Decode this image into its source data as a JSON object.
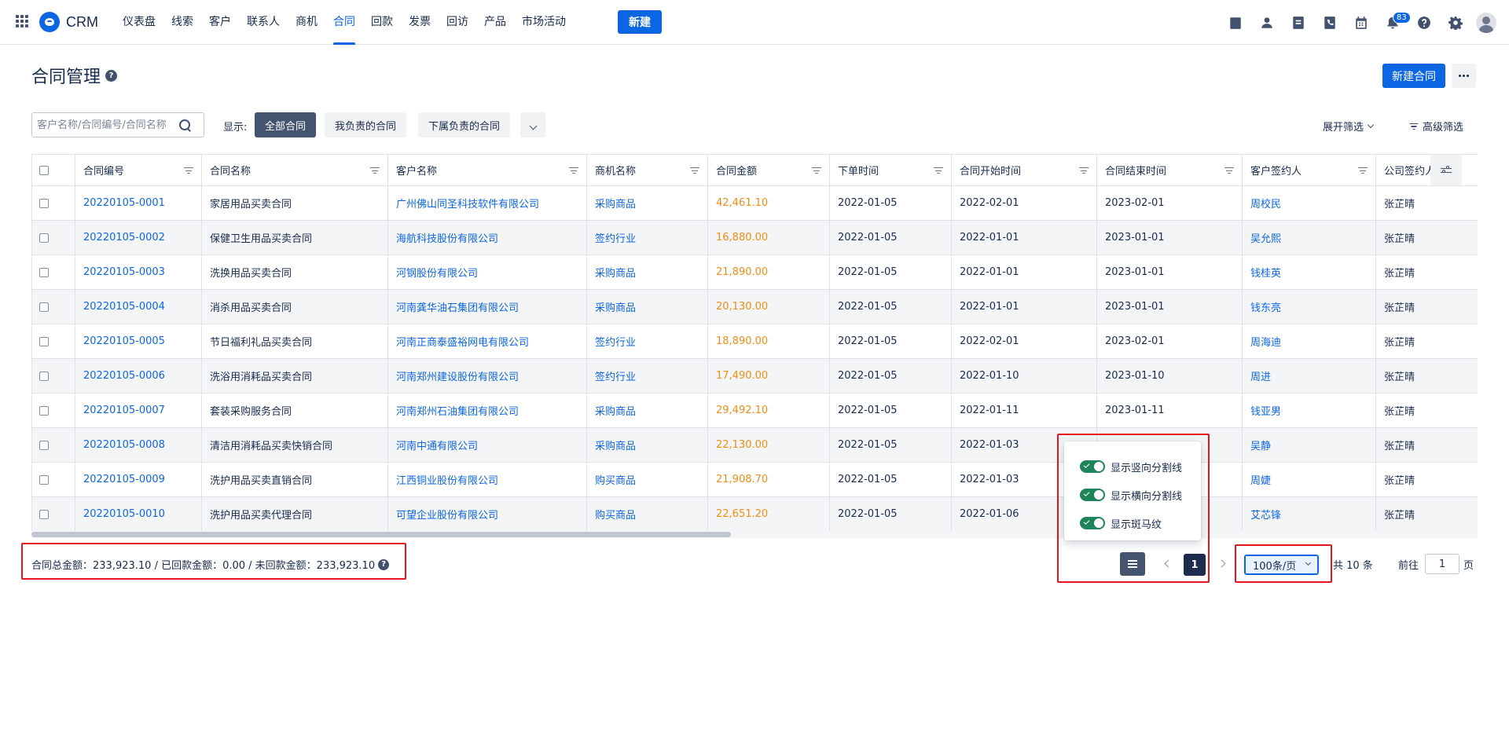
{
  "app": {
    "name": "CRM"
  },
  "nav": {
    "items": [
      "仪表盘",
      "线索",
      "客户",
      "联系人",
      "商机",
      "合同",
      "回款",
      "发票",
      "回访",
      "产品",
      "市场活动"
    ],
    "active_index": 5,
    "create_label": "新建"
  },
  "top_icons": {
    "items": [
      "task-icon",
      "contact-icon",
      "note-icon",
      "phone-icon",
      "calendar-icon",
      "bell-icon",
      "help-icon",
      "gear-icon",
      "avatar"
    ],
    "notification_count": "83"
  },
  "page": {
    "title": "合同管理",
    "help": "?",
    "new_contract_label": "新建合同"
  },
  "toolbar": {
    "search_placeholder": "客户名称/合同编号/合同名称",
    "show_label": "显示:",
    "segments": [
      "全部合同",
      "我负责的合同",
      "下属负责的合同"
    ],
    "active_segment": 0,
    "expand_filter_label": "展开筛选",
    "advanced_filter_label": "高级筛选"
  },
  "table": {
    "columns": [
      "合同编号",
      "合同名称",
      "客户名称",
      "商机名称",
      "合同金额",
      "下单时间",
      "合同开始时间",
      "合同结束时间",
      "客户签约人",
      "公司签约人"
    ],
    "rows": [
      [
        "20220105-0001",
        "家居用品买卖合同",
        "广州佛山同圣科技软件有限公司",
        "采购商品",
        "42,461.10",
        "2022-01-05",
        "2022-02-01",
        "2023-02-01",
        "周校民",
        "张芷晴"
      ],
      [
        "20220105-0002",
        "保健卫生用品买卖合同",
        "海航科技股份有限公司",
        "签约行业",
        "16,880.00",
        "2022-01-05",
        "2022-01-01",
        "2023-01-01",
        "吴允熙",
        "张芷晴"
      ],
      [
        "20220105-0003",
        "洗换用品买卖合同",
        "河钢股份有限公司",
        "采购商品",
        "21,890.00",
        "2022-01-05",
        "2022-01-01",
        "2023-01-01",
        "钱桂英",
        "张芷晴"
      ],
      [
        "20220105-0004",
        "消杀用品买卖合同",
        "河南龚华油石集团有限公司",
        "采购商品",
        "20,130.00",
        "2022-01-05",
        "2022-01-01",
        "2023-01-01",
        "钱东亮",
        "张芷晴"
      ],
      [
        "20220105-0005",
        "节日福利礼品买卖合同",
        "河南正商泰盛裕网电有限公司",
        "签约行业",
        "18,890.00",
        "2022-01-05",
        "2022-02-01",
        "2023-02-01",
        "周海迪",
        "张芷晴"
      ],
      [
        "20220105-0006",
        "洗浴用消耗品买卖合同",
        "河南郑州建设股份有限公司",
        "签约行业",
        "17,490.00",
        "2022-01-05",
        "2022-01-10",
        "2023-01-10",
        "周进",
        "张芷晴"
      ],
      [
        "20220105-0007",
        "套装采购服务合同",
        "河南郑州石油集团有限公司",
        "采购商品",
        "29,492.10",
        "2022-01-05",
        "2022-01-11",
        "2023-01-11",
        "钱亚男",
        "张芷晴"
      ],
      [
        "20220105-0008",
        "清洁用消耗品买卖快销合同",
        "河南中通有限公司",
        "采购商品",
        "22,130.00",
        "2022-01-05",
        "2022-01-03",
        "",
        "吴静",
        "张芷晴"
      ],
      [
        "20220105-0009",
        "洗护用品买卖直销合同",
        "江西铜业股份有限公司",
        "购买商品",
        "21,908.70",
        "2022-01-05",
        "2022-01-03",
        "",
        "周婕",
        "张芷晴"
      ],
      [
        "20220105-0010",
        "洗护用品买卖代理合同",
        "可望企业股份有限公司",
        "购买商品",
        "22,651.20",
        "2022-01-05",
        "2022-01-06",
        "",
        "艾芯锋",
        "张芷晴"
      ]
    ]
  },
  "footer": {
    "summary": "合同总金额：233,923.10 / 已回款金额：0.00 / 未回款金额：233,923.10",
    "current_page": "1",
    "page_size": "100条/页",
    "total": "共 10 条",
    "goto_label": "前往",
    "goto_value": "1",
    "page_suffix": "页"
  },
  "popover": {
    "options": [
      {
        "label": "显示竖向分割线",
        "on": true
      },
      {
        "label": "显示横向分割线",
        "on": true
      },
      {
        "label": "显示斑马纹",
        "on": true
      }
    ]
  },
  "colors": {
    "primary": "#0c66e4",
    "amount": "#f18d13",
    "toggle_on": "#1f845a",
    "highlight": "#e5141e"
  }
}
